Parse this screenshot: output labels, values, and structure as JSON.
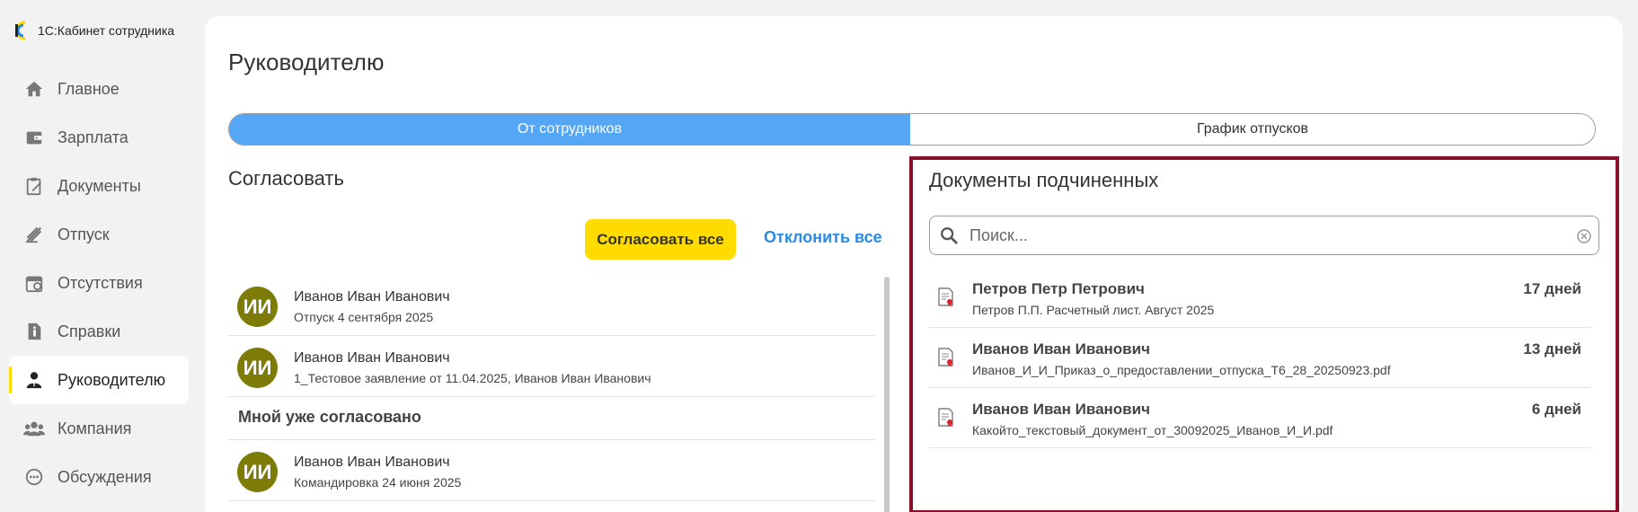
{
  "app": {
    "title": "1С:Кабинет сотрудника"
  },
  "sidebar": {
    "items": [
      {
        "label": "Главное",
        "icon": "home-icon"
      },
      {
        "label": "Зарплата",
        "icon": "wallet-icon"
      },
      {
        "label": "Документы",
        "icon": "clipboard-icon"
      },
      {
        "label": "Отпуск",
        "icon": "beach-icon"
      },
      {
        "label": "Отсутствия",
        "icon": "calendar-icon"
      },
      {
        "label": "Справки",
        "icon": "file-info-icon"
      },
      {
        "label": "Руководителю",
        "icon": "manager-icon",
        "active": true
      },
      {
        "label": "Компания",
        "icon": "people-icon"
      },
      {
        "label": "Обсуждения",
        "icon": "chat-icon"
      }
    ]
  },
  "page": {
    "title": "Руководителю"
  },
  "tabs": [
    {
      "label": "От сотрудников",
      "active": true
    },
    {
      "label": "График отпусков",
      "active": false
    }
  ],
  "approve": {
    "title": "Согласовать",
    "approve_all_label": "Согласовать все",
    "reject_all_label": "Отклонить все",
    "items": [
      {
        "initials": "ИИ",
        "name": "Иванов Иван Иванович",
        "detail": "Отпуск 4 сентября 2025"
      },
      {
        "initials": "ИИ",
        "name": "Иванов Иван Иванович",
        "detail": "1_Тестовое заявление от 11.04.2025, Иванов Иван Иванович"
      }
    ],
    "approved_group_label": "Мной уже согласовано",
    "approved_items": [
      {
        "initials": "ИИ",
        "name": "Иванов Иван Иванович",
        "detail": "Командировка 24 июня 2025"
      }
    ]
  },
  "docs": {
    "title": "Документы подчиненных",
    "search_placeholder": "Поиск...",
    "items": [
      {
        "name": "Петров Петр Петрович",
        "file": "Петров П.П. Расчетный лист. Август 2025",
        "days": "17 дней"
      },
      {
        "name": "Иванов Иван Иванович",
        "file": "Иванов_И_И_Приказ_о_предоставлении_отпуска_Т6_28_20250923.pdf",
        "days": "13 дней"
      },
      {
        "name": "Иванов Иван Иванович",
        "file": "Какойто_текстовый_документ_от_30092025_Иванов_И_И.pdf",
        "days": "6 дней"
      }
    ]
  },
  "colors": {
    "accent_blue": "#55a6f5",
    "link_blue": "#2b8ae6",
    "yellow": "#ffdb00",
    "avatar_olive": "#7e7c08",
    "highlight_border": "#8b0f2a"
  }
}
